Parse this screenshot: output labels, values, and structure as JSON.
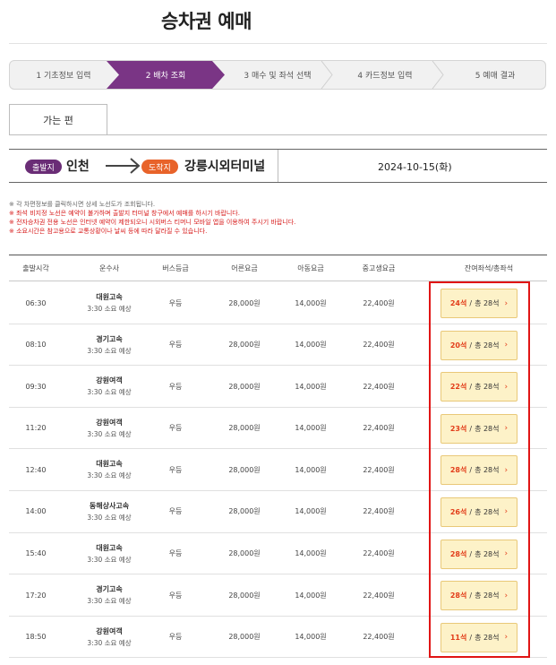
{
  "page_title": "승차권 예매",
  "steps": [
    {
      "label": "1 기초정보 입력",
      "active": false
    },
    {
      "label": "2 배차 조회",
      "active": true
    },
    {
      "label": "3 매수 및 좌석 선택",
      "active": false
    },
    {
      "label": "4 카드정보 입력",
      "active": false
    },
    {
      "label": "5 예매 결과",
      "active": false
    }
  ],
  "tab_label": "가는 편",
  "route": {
    "departure_badge": "출발지",
    "departure": "인천",
    "arrival_badge": "도착지",
    "arrival": "강릉시외터미널",
    "date": "2024-10-15(화)"
  },
  "notices": [
    {
      "text": "※ 각 차편정보를 클릭하시면 상세 노선도가 조회됩니다.",
      "red": false
    },
    {
      "text": "※ 좌석 비지정 노선은 예약이 불가하며 출발지 터미널 창구에서 예매를 하시기 바랍니다.",
      "red": true
    },
    {
      "text": "※ 전자승차권 전용 노선은 인터넷 예약이 제한되오니 시외버스 티머니 모바일 앱을 이용하여 주시기 바랍니다.",
      "red": true
    },
    {
      "text": "※ 소요시간은 참고용으로 교통상황이나 날씨 등에 따라 달라질 수 있습니다.",
      "red": true
    }
  ],
  "table": {
    "headers": {
      "time": "출발시각",
      "company": "운수사",
      "grade": "버스등급",
      "adult": "어른요금",
      "child": "아동요금",
      "student": "중고생요금",
      "seats": "잔여좌석/총좌석"
    },
    "rows": [
      {
        "time": "06:30",
        "company": "대원고속",
        "duration": "3:30 소요 예상",
        "grade": "우등",
        "adult": "28,000원",
        "child": "14,000원",
        "student": "22,400원",
        "remain": "24석",
        "total": "총 28석"
      },
      {
        "time": "08:10",
        "company": "경기고속",
        "duration": "3:30 소요 예상",
        "grade": "우등",
        "adult": "28,000원",
        "child": "14,000원",
        "student": "22,400원",
        "remain": "20석",
        "total": "총 28석"
      },
      {
        "time": "09:30",
        "company": "강원여객",
        "duration": "3:30 소요 예상",
        "grade": "우등",
        "adult": "28,000원",
        "child": "14,000원",
        "student": "22,400원",
        "remain": "22석",
        "total": "총 28석"
      },
      {
        "time": "11:20",
        "company": "강원여객",
        "duration": "3:30 소요 예상",
        "grade": "우등",
        "adult": "28,000원",
        "child": "14,000원",
        "student": "22,400원",
        "remain": "23석",
        "total": "총 28석"
      },
      {
        "time": "12:40",
        "company": "대원고속",
        "duration": "3:30 소요 예상",
        "grade": "우등",
        "adult": "28,000원",
        "child": "14,000원",
        "student": "22,400원",
        "remain": "28석",
        "total": "총 28석"
      },
      {
        "time": "14:00",
        "company": "동해상사고속",
        "duration": "3:30 소요 예상",
        "grade": "우등",
        "adult": "28,000원",
        "child": "14,000원",
        "student": "22,400원",
        "remain": "26석",
        "total": "총 28석"
      },
      {
        "time": "15:40",
        "company": "대원고속",
        "duration": "3:30 소요 예상",
        "grade": "우등",
        "adult": "28,000원",
        "child": "14,000원",
        "student": "22,400원",
        "remain": "28석",
        "total": "총 28석"
      },
      {
        "time": "17:20",
        "company": "경기고속",
        "duration": "3:30 소요 예상",
        "grade": "우등",
        "adult": "28,000원",
        "child": "14,000원",
        "student": "22,400원",
        "remain": "28석",
        "total": "총 28석"
      },
      {
        "time": "18:50",
        "company": "강원여객",
        "duration": "3:30 소요 예상",
        "grade": "우등",
        "adult": "28,000원",
        "child": "14,000원",
        "student": "22,400원",
        "remain": "11석",
        "total": "총 28석"
      }
    ]
  },
  "colors": {
    "primary": "#7a3585",
    "departure_badge": "#6a2d76",
    "arrival_badge": "#e8632a",
    "seat_button_bg": "#fdf2c8",
    "available_text": "#e23d1a",
    "highlight_border": "#e01515"
  },
  "icons": {
    "route_arrow": "arrow-right-icon",
    "seat_chevron": "chevron-right-icon"
  }
}
